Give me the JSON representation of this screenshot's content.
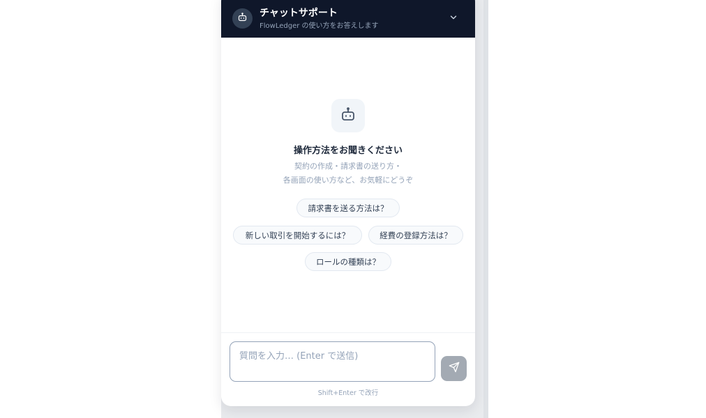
{
  "header": {
    "title": "チャットサポート",
    "subtitle": "FlowLedger の使い方をお答えします",
    "avatar_icon": "bot-icon",
    "collapse_icon": "chevron-down-icon",
    "background": "#0f172a"
  },
  "empty_state": {
    "icon": "bot-icon",
    "title": "操作方法をお聞きください",
    "description_lines": [
      "契約の作成・請求書の送り方・",
      "各画面の使い方など、お気軽にどうぞ"
    ]
  },
  "suggestions": [
    "請求書を送る方法は？",
    "新しい取引を開始するには？",
    "経費の登録方法は？",
    "ロールの種類は？"
  ],
  "composer": {
    "placeholder": "質問を入力… (Enter で送信)",
    "value": "",
    "send_icon": "send-icon",
    "hint": "Shift+Enter で改行"
  },
  "colors": {
    "header_bg": "#0f172a",
    "send_button_disabled": "#a3aab3",
    "muted_text": "#94a3b8"
  }
}
